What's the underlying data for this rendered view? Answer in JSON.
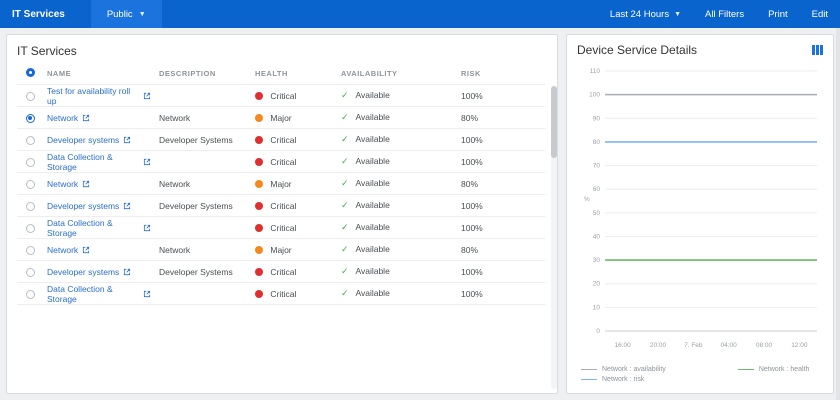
{
  "colors": {
    "critical": "#e12e2e",
    "major": "#f5891f",
    "available": "#3fae49",
    "accent": "#0a64ce",
    "link": "#2a6fc9"
  },
  "header": {
    "title": "IT Services",
    "visibility": "Public",
    "time_range": "Last 24 Hours",
    "all_filters": "All Filters",
    "print": "Print",
    "edit": "Edit"
  },
  "left_panel": {
    "title": "IT Services",
    "table": {
      "columns": [
        "Name",
        "Description",
        "Health",
        "Availability",
        "Risk"
      ],
      "rows": [
        {
          "name": "Test for availability roll up",
          "description": "",
          "severity": "critical",
          "health": "Critical",
          "availability": "Available",
          "risk": "100%",
          "selected": false
        },
        {
          "name": "Network",
          "description": "Network",
          "severity": "major",
          "health": "Major",
          "availability": "Available",
          "risk": "80%",
          "selected": true
        },
        {
          "name": "Developer systems",
          "description": "Developer Systems",
          "severity": "critical",
          "health": "Critical",
          "availability": "Available",
          "risk": "100%",
          "selected": false
        },
        {
          "name": "Data Collection & Storage",
          "description": "",
          "severity": "critical",
          "health": "Critical",
          "availability": "Available",
          "risk": "100%",
          "selected": false
        },
        {
          "name": "Network",
          "description": "Network",
          "severity": "major",
          "health": "Major",
          "availability": "Available",
          "risk": "80%",
          "selected": false
        },
        {
          "name": "Developer systems",
          "description": "Developer Systems",
          "severity": "critical",
          "health": "Critical",
          "availability": "Available",
          "risk": "100%",
          "selected": false
        },
        {
          "name": "Data Collection & Storage",
          "description": "",
          "severity": "critical",
          "health": "Critical",
          "availability": "Available",
          "risk": "100%",
          "selected": false
        },
        {
          "name": "Network",
          "description": "Network",
          "severity": "major",
          "health": "Major",
          "availability": "Available",
          "risk": "80%",
          "selected": false
        },
        {
          "name": "Developer systems",
          "description": "Developer Systems",
          "severity": "critical",
          "health": "Critical",
          "availability": "Available",
          "risk": "100%",
          "selected": false
        },
        {
          "name": "Data Collection & Storage",
          "description": "",
          "severity": "critical",
          "health": "Critical",
          "availability": "Available",
          "risk": "100%",
          "selected": false
        }
      ]
    }
  },
  "right_panel": {
    "title": "Device Service Details"
  },
  "chart_data": {
    "type": "line",
    "title": "Device Service Details",
    "ylabel": "%",
    "xlabel": "",
    "ylim": [
      0,
      110
    ],
    "y_ticks": [
      0,
      10,
      20,
      30,
      40,
      50,
      60,
      70,
      80,
      90,
      100,
      110
    ],
    "x_ticks": [
      "16:00",
      "20:00",
      "7. Feb",
      "04:00",
      "08:00",
      "12:00"
    ],
    "grid": true,
    "legend_position": "bottom-left",
    "series": [
      {
        "name": "Network : availability",
        "color": "#a9adb1",
        "values": [
          100,
          100,
          100,
          100,
          100,
          100
        ]
      },
      {
        "name": "Network : risk",
        "color": "#7db5e8",
        "values": [
          80,
          80,
          80,
          80,
          80,
          80
        ]
      },
      {
        "name": "Network : health",
        "color": "#6cba6c",
        "values": [
          30,
          30,
          30,
          30,
          30,
          30
        ]
      }
    ]
  }
}
